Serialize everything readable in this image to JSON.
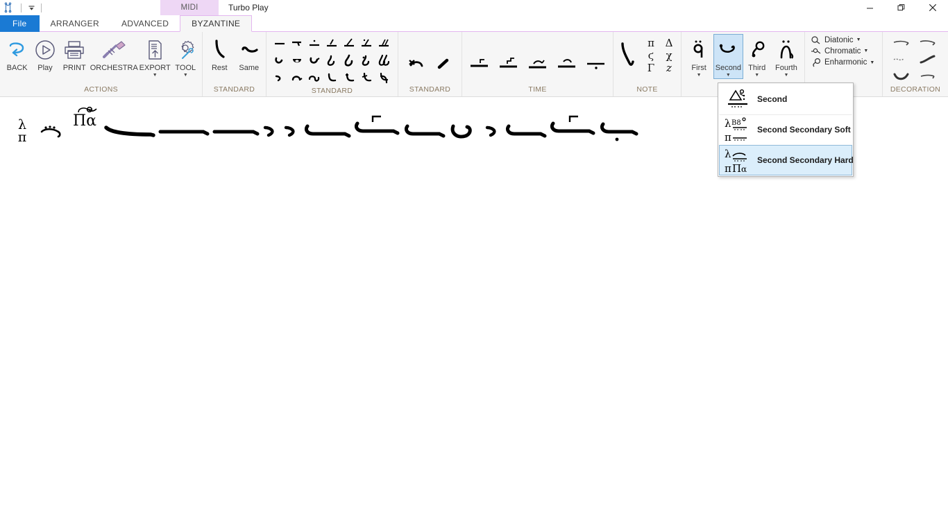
{
  "window": {
    "title": "Turbo Play",
    "contextual_tab_header": "MIDI",
    "quick_access": {
      "app_icon": "byzantine-note-icon",
      "customize_icon": "chevron-down-icon"
    },
    "controls": {
      "minimize": "minimize-icon",
      "restore": "restore-icon",
      "close": "close-icon"
    }
  },
  "tabs": [
    {
      "label": "File",
      "active": false,
      "kind": "file"
    },
    {
      "label": "ARRANGER",
      "active": false,
      "kind": "normal"
    },
    {
      "label": "ADVANCED",
      "active": false,
      "kind": "normal"
    },
    {
      "label": "BYZANTINE",
      "active": true,
      "kind": "normal"
    }
  ],
  "ribbon": {
    "groups": [
      {
        "name": "actions",
        "label": "ACTIONS",
        "buttons": [
          {
            "label": "BACK",
            "icon": "undo-arrow-icon",
            "caret": false
          },
          {
            "label": "Play",
            "icon": "play-circle-icon",
            "caret": false
          },
          {
            "label": "PRINT",
            "icon": "printer-icon",
            "caret": false
          },
          {
            "label": "ORCHESTRA",
            "icon": "trumpet-icon",
            "caret": false
          },
          {
            "label": "EXPORT",
            "icon": "document-export-icon",
            "caret": true
          },
          {
            "label": "TOOL",
            "icon": "gear-wrench-icon",
            "caret": true
          }
        ]
      },
      {
        "name": "standard-rest",
        "label": "STANDARD",
        "buttons": [
          {
            "label": "Rest",
            "icon": "rest-neume-icon",
            "caret": false
          },
          {
            "label": "Same",
            "icon": "ison-neume-icon",
            "caret": false
          }
        ]
      },
      {
        "name": "standard-neumes",
        "label": "STANDARD",
        "rows": 3,
        "cols": 7,
        "tiles": [
          "ison-icon",
          "apostrofos-icon",
          "oligon-kentima-icon",
          "oligon-slash-icon",
          "petasti-icon",
          "oligon-double-icon",
          "kentimata-icon",
          "elafron-icon",
          "hamili-icon",
          "apostrofos-curl-icon",
          "elafron-apostrofos-icon",
          "hamili-apostrofos-icon",
          "hamili-elafron-icon",
          "double-hamili-icon",
          "apostrofos-small-icon",
          "elafron-small-icon",
          "kentima-loop-icon",
          "hook-icon",
          "hook2-icon",
          "ypporroi-icon",
          "kratimata-icon"
        ]
      },
      {
        "name": "standard-extra",
        "label": "STANDARD",
        "rows": 1,
        "cols": 2,
        "tiles": [
          "gorgon-cross-icon",
          "slash-stroke-icon"
        ]
      },
      {
        "name": "time",
        "label": "TIME",
        "rows": 1,
        "cols": 5,
        "tiles": [
          "klasma-bar-icon",
          "klasma-step-icon",
          "gorgon-bar-icon",
          "digorgon-bar-icon",
          "aple-dot-icon"
        ]
      },
      {
        "name": "note",
        "label": "NOTE",
        "main_glyph": "psifiston-icon",
        "letters": [
          [
            "π",
            "Δ"
          ],
          [
            "ϛ",
            "χ"
          ],
          [
            "Γ",
            "z"
          ]
        ]
      },
      {
        "name": "martyria",
        "label": "",
        "buttons": [
          {
            "label": "First",
            "icon": "first-martyria-icon",
            "caret": true,
            "selected": false
          },
          {
            "label": "Second",
            "icon": "second-martyria-icon",
            "caret": true,
            "selected": true
          },
          {
            "label": "Third",
            "icon": "third-martyria-icon",
            "caret": true,
            "selected": false
          },
          {
            "label": "Fourth",
            "icon": "fourth-martyria-icon",
            "caret": true,
            "selected": false
          }
        ]
      },
      {
        "name": "genera",
        "label": "RA",
        "rows": [
          {
            "label": "Diatonic",
            "icon": "diatonic-sign-icon",
            "caret": true
          },
          {
            "label": "Chromatic",
            "icon": "chromatic-sign-icon",
            "caret": true
          },
          {
            "label": "Enharmonic",
            "icon": "enharmonic-sign-icon",
            "caret": true
          }
        ]
      },
      {
        "name": "decoration",
        "label": "DECORATION",
        "rows": 3,
        "cols": 2,
        "tiles": [
          "psifiston-dec-icon",
          "omalon-dec-icon",
          "antikenoma-dec-icon",
          "heteron-dec-icon",
          "endofonon-dec-icon",
          "stavros-dec-icon"
        ]
      }
    ]
  },
  "dropdown": {
    "open_for": "Second",
    "items": [
      {
        "label": "Second",
        "icon": "second-martyria-menu-icon",
        "highlighted": false
      },
      {
        "label": "Second Secondary Soft",
        "icon": "second-soft-menu-icon",
        "highlighted": false
      },
      {
        "label": "Second Secondary Hard",
        "icon": "second-hard-menu-icon",
        "highlighted": true
      }
    ]
  },
  "document": {
    "line_label_top": "λ",
    "line_label_bottom": "π",
    "mode_label": "Πα",
    "neumes": [
      "martyria-lambda-pi",
      "gorgon-group",
      "pa-martyria",
      "ison-long",
      "ison-long",
      "ison-long",
      "apostrofos",
      "apostrofos",
      "elafron-ison",
      "elafron-klasma",
      "elafron-ison",
      "hamili-loop",
      "apostrofos",
      "elafron-ison",
      "elafron-klasma",
      "elafron-dot"
    ]
  },
  "colors": {
    "accent_blue": "#1a7ad4",
    "contextual_purple": "#eed7f5",
    "tab_border_pink": "#e3b6ef",
    "ribbon_bg": "#f6f6f6",
    "group_label": "#8a7a63",
    "selected_button": "#cde4f7",
    "menu_highlight": "#dbeefb"
  }
}
